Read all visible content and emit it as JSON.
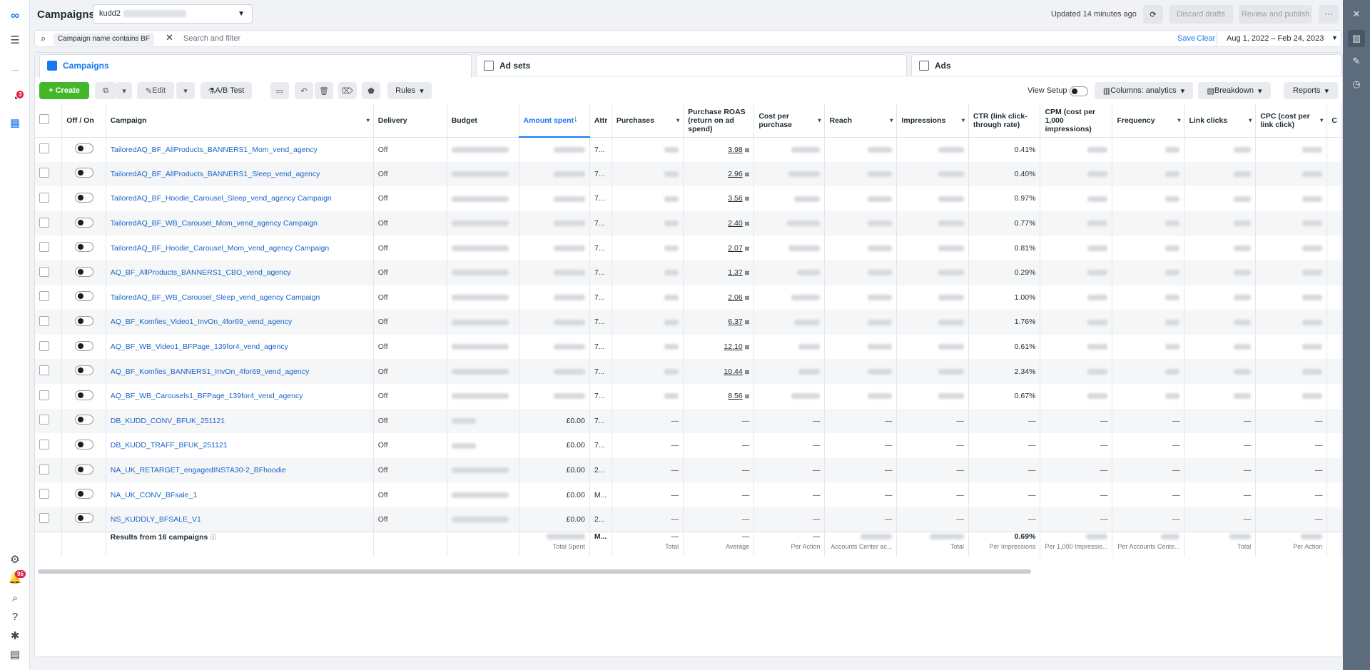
{
  "page": {
    "title": "Campaigns",
    "account_name": "kudd2",
    "updated": "Updated 14 minutes ago",
    "discard": "Discard drafts",
    "review": "Review and publish",
    "more": "···"
  },
  "filter": {
    "chip": "Campaign name contains BF",
    "placeholder": "Search and filter",
    "save": "Save",
    "clear": "Clear",
    "date_range": "Aug 1, 2022 – Feb 24, 2023"
  },
  "tabs": [
    {
      "label": "Campaigns"
    },
    {
      "label": "Ad sets"
    },
    {
      "label": "Ads"
    }
  ],
  "toolbar": {
    "create": "+ Create",
    "edit": "Edit",
    "ab_test": "A/B Test",
    "rules": "Rules",
    "view_setup": "View Setup",
    "columns": "Columns: analytics",
    "breakdown": "Breakdown",
    "reports": "Reports"
  },
  "leftnav": {
    "notifications_badge": "3",
    "alerts_badge": "95"
  },
  "columns": [
    "Off / On",
    "Campaign",
    "Delivery",
    "Budget",
    "Amount spent",
    "Attr setting",
    "Purchases",
    "Purchase ROAS (return on ad spend)",
    "Cost per purchase",
    "Reach",
    "Impressions",
    "CTR (link click-through rate)",
    "CPM (cost per 1,000 impressions)",
    "Frequency",
    "Link clicks",
    "CPC (cost per link click)",
    "C"
  ],
  "rows": [
    {
      "name": "TailoredAQ_BF_AllProducts_BANNERS1_Mom_vend_agency",
      "delivery": "Off",
      "attr": "7...",
      "roas": "3.98",
      "ctr": "0.41%"
    },
    {
      "name": "TailoredAQ_BF_AllProducts_BANNERS1_Sleep_vend_agency",
      "delivery": "Off",
      "attr": "7...",
      "roas": "2.96",
      "ctr": "0.40%"
    },
    {
      "name": "TailoredAQ_BF_Hoodie_Carousel_Sleep_vend_agency Campaign",
      "delivery": "Off",
      "attr": "7...",
      "roas": "3.56",
      "ctr": "0.97%"
    },
    {
      "name": "TailoredAQ_BF_WB_Carousel_Mom_vend_agency Campaign",
      "delivery": "Off",
      "attr": "7...",
      "roas": "2.40",
      "ctr": "0.77%"
    },
    {
      "name": "TailoredAQ_BF_Hoodie_Carousel_Mom_vend_agency Campaign",
      "delivery": "Off",
      "attr": "7...",
      "roas": "2.07",
      "ctr": "0.81%"
    },
    {
      "name": "AQ_BF_AllProducts_BANNERS1_CBO_vend_agency",
      "delivery": "Off",
      "attr": "7...",
      "roas": "1.37",
      "ctr": "0.29%"
    },
    {
      "name": "TailoredAQ_BF_WB_Carousel_Sleep_vend_agency Campaign",
      "delivery": "Off",
      "attr": "7...",
      "roas": "2.06",
      "ctr": "1.00%"
    },
    {
      "name": "AQ_BF_Komfies_Video1_InvOn_4for69_vend_agency",
      "delivery": "Off",
      "attr": "7...",
      "roas": "6.37",
      "ctr": "1.76%"
    },
    {
      "name": "AQ_BF_WB_Video1_BFPage_139for4_vend_agency",
      "delivery": "Off",
      "attr": "7...",
      "roas": "12.10",
      "ctr": "0.61%"
    },
    {
      "name": "AQ_BF_Komfies_BANNERS1_InvOn_4for69_vend_agency",
      "delivery": "Off",
      "attr": "7...",
      "roas": "10.44",
      "ctr": "2.34%"
    },
    {
      "name": "AQ_BF_WB_Carousels1_BFPage_139for4_vend_agency",
      "delivery": "Off",
      "attr": "7...",
      "roas": "8.56",
      "ctr": "0.67%"
    },
    {
      "name": "DB_KUDD_CONV_BFUK_251121",
      "delivery": "Off",
      "attr": "7...",
      "spent": "£0.00"
    },
    {
      "name": "DB_KUDD_TRAFF_BFUK_251121",
      "delivery": "Off",
      "attr": "7...",
      "spent": "£0.00"
    },
    {
      "name": "NA_UK_RETARGET_engagedINSTA30-2_BFhoodie",
      "delivery": "Off",
      "attr": "2...",
      "spent": "£0.00"
    },
    {
      "name": "NA_UK_CONV_BFsale_1",
      "delivery": "Off",
      "attr": "M...",
      "spent": "£0.00"
    },
    {
      "name": "NS_KUDDLY_BFSALE_V1",
      "delivery": "Off",
      "attr": "2...",
      "spent": "£0.00"
    }
  ],
  "dash": "—",
  "footer": {
    "results": "Results from 16 campaigns",
    "attr": "M...",
    "ctr": "0.69%",
    "labels": {
      "spent": "Total Spent",
      "purchases": "Total",
      "roas": "Average",
      "cpp": "Per Action",
      "reach": "Accounts Center ac...",
      "impr": "Total",
      "ctr": "Per Impressions",
      "cpm": "Per 1,000 Impressio...",
      "freq": "Per Accounts Cente...",
      "clicks": "Total",
      "cpc": "Per Action"
    }
  }
}
